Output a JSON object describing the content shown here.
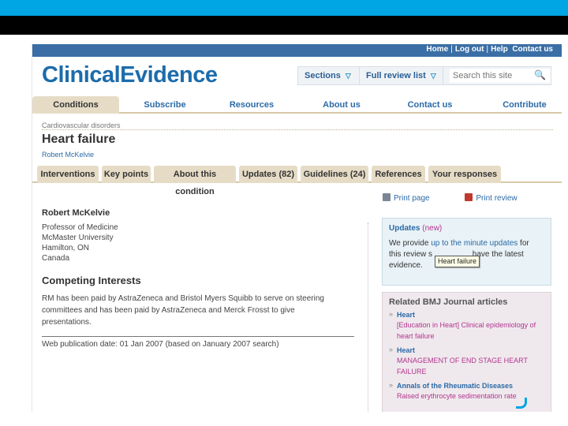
{
  "site": {
    "logo_part1": "Clinical",
    "logo_part2": "Evidence",
    "util_links": [
      "Home",
      "Log out",
      "Help",
      "Contact us"
    ],
    "sections_label": "Sections",
    "full_review_label": "Full review list",
    "search_placeholder": "Search this site"
  },
  "main_nav": [
    "Conditions",
    "Subscribe",
    "Resources",
    "About us",
    "Contact us",
    "Contribute"
  ],
  "breadcrumb": "Cardiovascular disorders",
  "title": "Heart failure",
  "author_link": "Robert McKelvie",
  "sub_tabs": [
    "Interventions",
    "Key points",
    "About this condition",
    "Updates (82)",
    "Guidelines (24)",
    "References",
    "Your responses"
  ],
  "author": {
    "name": "Robert McKelvie",
    "address": [
      "Professor of Medicine",
      "McMaster University",
      "Hamilton, ON",
      "Canada"
    ]
  },
  "competing": {
    "heading": "Competing Interests",
    "text": "RM has been paid by AstraZeneca and Bristol Myers Squibb to serve on steering committees and has been paid by AstraZeneca and Merck Frosst to give presentations.",
    "pubdate": "Web publication date: 01 Jan 2007 (based on January 2007 search)"
  },
  "actions": {
    "print_page": "Print page",
    "print_review": "Print review"
  },
  "updates_box": {
    "title": "Updates",
    "new": "(new)",
    "line1_a": "We provide ",
    "line1_link": "up to the minute updates",
    "line1_b": " for",
    "line2_a": "this review s",
    "line2_b": " have the latest",
    "line3": "evidence.",
    "tooltip": "Heart failure"
  },
  "related": {
    "heading": "Related BMJ Journal articles",
    "items": [
      {
        "journal": "Heart",
        "article": "[Education in Heart] Clinical epidemiology of heart failure"
      },
      {
        "journal": "Heart",
        "article": "MANAGEMENT OF END STAGE HEART FAILURE"
      },
      {
        "journal": "Annals of the Rheumatic Diseases",
        "article": "Raised erythrocyte sedimentation rate"
      }
    ]
  },
  "colors": {
    "slide_accent": "#00a5e3",
    "brand_blue": "#1c6cab",
    "link_blue": "#2b6aa7",
    "tab_beige": "#e6dcc6",
    "magenta": "#b3348f"
  }
}
